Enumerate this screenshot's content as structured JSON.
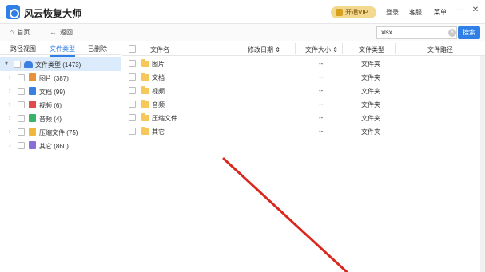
{
  "app": {
    "title": "风云恢复大师",
    "vip_label": "开通VIP",
    "login_label": "登录",
    "help_label": "客服",
    "menu_label": "菜单",
    "minimize_glyph": "—",
    "close_glyph": "✕"
  },
  "nav": {
    "home_label": "首页",
    "back_label": "返回",
    "home_glyph": "⌂",
    "back_glyph": "←",
    "search_value": "xlsx",
    "search_button": "搜索",
    "clear_glyph": "×"
  },
  "left": {
    "tabs": [
      {
        "label": "路径视图"
      },
      {
        "label": "文件类型"
      },
      {
        "label": "已删除"
      }
    ],
    "root": {
      "label": "文件类型 (1473)",
      "arrow": "▾"
    },
    "items": [
      {
        "label": "图片 (387)",
        "arrow": "›",
        "color": "#e8903a"
      },
      {
        "label": "文档 (99)",
        "arrow": "›",
        "color": "#3b7fe0"
      },
      {
        "label": "视频 (6)",
        "arrow": "›",
        "color": "#e04b4b"
      },
      {
        "label": "音频 (4)",
        "arrow": "›",
        "color": "#39b36a"
      },
      {
        "label": "压缩文件 (75)",
        "arrow": "›",
        "color": "#f0b83a"
      },
      {
        "label": "其它 (860)",
        "arrow": "›",
        "color": "#8a6fd6"
      }
    ]
  },
  "table": {
    "headers": {
      "name": "文件名",
      "date": "修改日期",
      "size": "文件大小",
      "type": "文件类型",
      "path": "文件路径",
      "sort_glyph": "⇕"
    },
    "rows": [
      {
        "name": "图片",
        "date": "",
        "size": "--",
        "type": "文件夹"
      },
      {
        "name": "文档",
        "date": "",
        "size": "--",
        "type": "文件夹"
      },
      {
        "name": "视频",
        "date": "",
        "size": "--",
        "type": "文件夹"
      },
      {
        "name": "音频",
        "date": "",
        "size": "--",
        "type": "文件夹"
      },
      {
        "name": "压缩文件",
        "date": "",
        "size": "--",
        "type": "文件夹"
      },
      {
        "name": "其它",
        "date": "",
        "size": "--",
        "type": "文件夹"
      }
    ]
  },
  "colors": {
    "accent": "#2f7fe6",
    "annotation_arrow": "#d9281e"
  }
}
